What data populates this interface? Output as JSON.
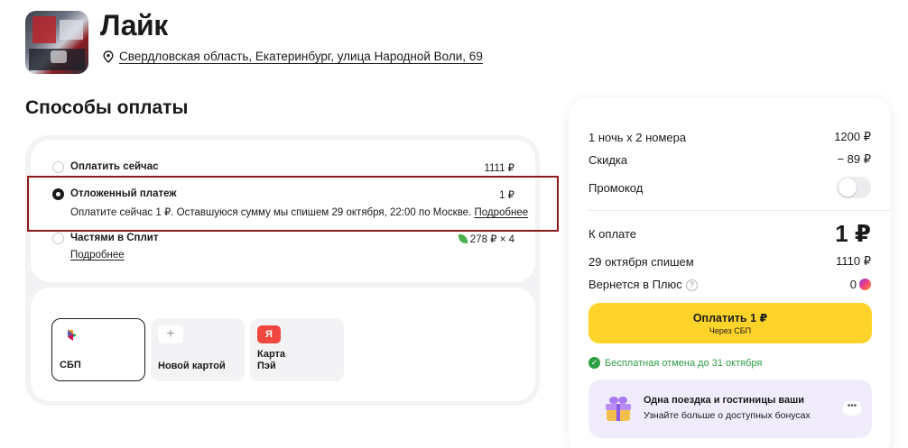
{
  "hotel": {
    "name": "Лайк",
    "address": "Свердловская область, Екатеринбург, улица Народной Воли, 69"
  },
  "payment": {
    "title": "Способы оплаты",
    "options": [
      {
        "label": "Оплатить сейчас",
        "price": "1111 ₽",
        "checked": false
      },
      {
        "label": "Отложенный платеж",
        "price": "1 ₽",
        "checked": true,
        "description": "Оплатите сейчас 1 ₽. Оставшуюся сумму мы спишем 29 октября, 22:00 по Москве.",
        "link": "Подробнее"
      },
      {
        "label": "Частями в Сплит",
        "price": "278 ₽ × 4",
        "checked": false,
        "link": "Подробнее"
      }
    ],
    "methods": [
      {
        "label": "СБП",
        "icon": "sbp-icon",
        "selected": true
      },
      {
        "label": "Новой картой",
        "icon": "plus-icon",
        "selected": false
      },
      {
        "label_line1": "Карта",
        "label_line2": "Пэй",
        "icon_text": "Я",
        "icon": "yandex-pay-icon",
        "selected": false
      }
    ]
  },
  "summary": {
    "nights_label": "1 ночь х 2 номера",
    "nights_value": "1200 ₽",
    "discount_label": "Скидка",
    "discount_value": "− 89 ₽",
    "promo_label": "Промокод",
    "to_pay_label": "К оплате",
    "to_pay_value": "1 ₽",
    "charge_label": "29 октября спишем",
    "charge_value": "1110 ₽",
    "plus_label": "Вернется в Плюс",
    "plus_help": "?",
    "plus_value": "0",
    "pay_button": "Оплатить 1 ₽",
    "pay_button_sub": "Через СБП",
    "free_cancel": "Бесплатная отмена до 31 октября",
    "promo_title": "Одна поездка и гостиницы ваши",
    "promo_sub": "Узнайте больше о доступных бонусах",
    "promo_more": "•••"
  },
  "colors": {
    "pay_button": "#ffd42a",
    "highlight_border": "#8b1a1a",
    "free_cancel": "#2e9e44",
    "promo_bg": "#f1ecfc"
  }
}
